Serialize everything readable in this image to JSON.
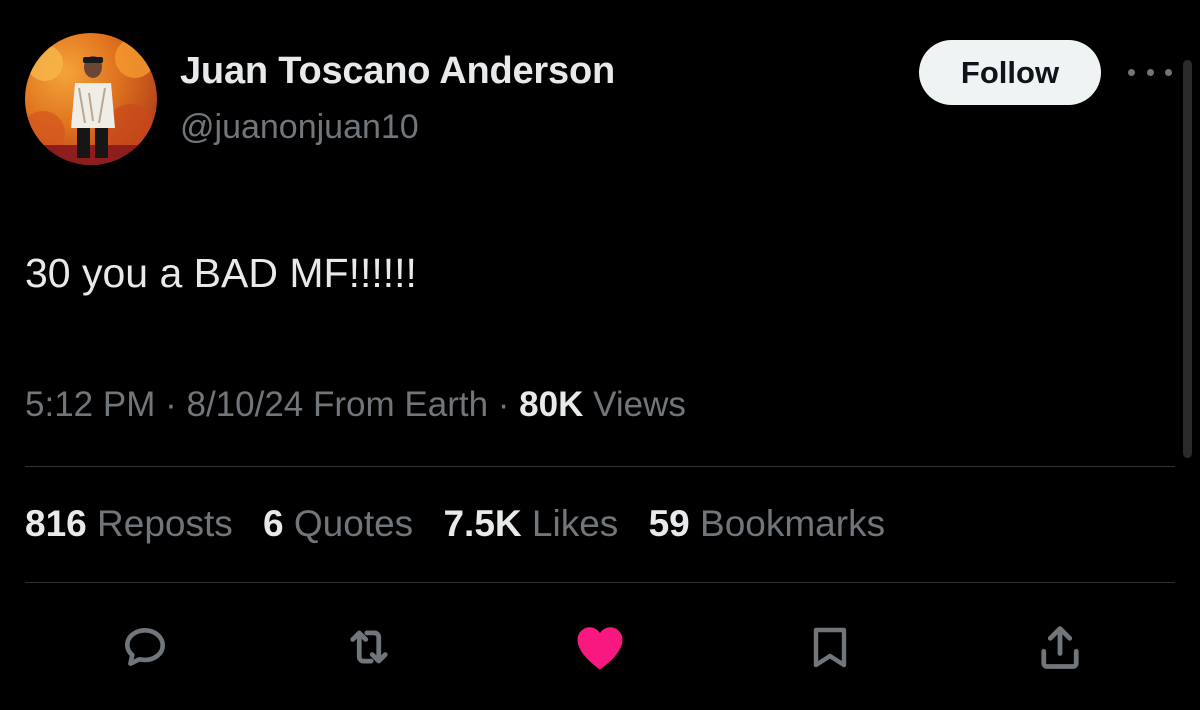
{
  "profile": {
    "display_name": "Juan Toscano Anderson",
    "handle": "@juanonjuan10",
    "avatar_icon": "profile-photo"
  },
  "header": {
    "follow_label": "Follow",
    "more_icon": "more-horizontal-icon"
  },
  "tweet": {
    "text": "30 you a BAD MF!!!!!!"
  },
  "meta": {
    "time": "5:12 PM",
    "sep1": "·",
    "date": "8/10/24",
    "location": "From Earth",
    "sep2": "·",
    "views_count": "80K",
    "views_label": "Views"
  },
  "stats": {
    "reposts": {
      "count": "816",
      "label": "Reposts"
    },
    "quotes": {
      "count": "6",
      "label": "Quotes"
    },
    "likes": {
      "count": "7.5K",
      "label": "Likes"
    },
    "bookmarks": {
      "count": "59",
      "label": "Bookmarks"
    }
  },
  "actions": {
    "reply_icon": "reply-icon",
    "repost_icon": "repost-icon",
    "like_icon": "heart-icon",
    "bookmark_icon": "bookmark-icon",
    "share_icon": "share-icon"
  },
  "colors": {
    "background": "#000000",
    "text_primary": "#e7e9ea",
    "text_secondary": "#71767b",
    "like_active": "#f91880",
    "divider": "#2f3336",
    "follow_bg": "#eff3f4"
  }
}
